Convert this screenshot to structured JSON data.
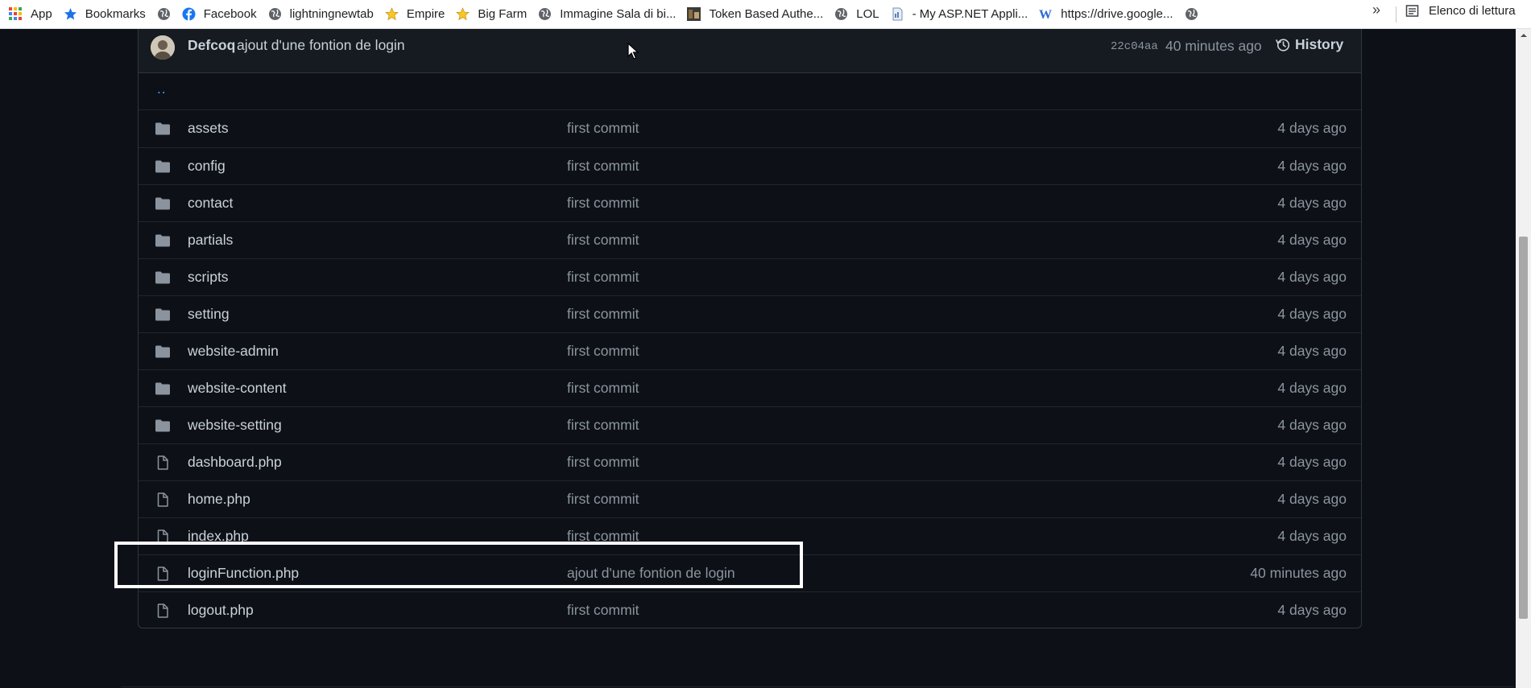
{
  "bookmarks": {
    "items": [
      {
        "label": "App",
        "icon": "apps-grid-icon"
      },
      {
        "label": "Bookmarks",
        "icon": "star-icon"
      },
      {
        "label": "",
        "icon": "globe-icon"
      },
      {
        "label": "Facebook",
        "icon": "facebook-icon"
      },
      {
        "label": "lightningnewtab",
        "icon": "globe-icon"
      },
      {
        "label": "Empire",
        "icon": "star-icon"
      },
      {
        "label": "Big Farm",
        "icon": "star-icon"
      },
      {
        "label": "Immagine Sala di bi...",
        "icon": "globe-icon"
      },
      {
        "label": "Token Based Authe...",
        "icon": "site-icon"
      },
      {
        "label": "LOL",
        "icon": "globe-icon"
      },
      {
        "label": "- My ASP.NET Appli...",
        "icon": "document-icon"
      },
      {
        "label": "https://drive.google...",
        "icon": "w-icon"
      },
      {
        "label": "",
        "icon": "globe-icon"
      }
    ],
    "overflow": "»",
    "reading_list": "Elenco di lettura"
  },
  "commit": {
    "author": "Defcoq",
    "message": "ajout d'une fontion de login",
    "sha": "22c04aa",
    "time": "40 minutes ago",
    "history_label": "History"
  },
  "parent_link": "..",
  "files": [
    {
      "name": "assets",
      "type": "folder",
      "message": "first commit",
      "age": "4 days ago"
    },
    {
      "name": "config",
      "type": "folder",
      "message": "first commit",
      "age": "4 days ago"
    },
    {
      "name": "contact",
      "type": "folder",
      "message": "first commit",
      "age": "4 days ago"
    },
    {
      "name": "partials",
      "type": "folder",
      "message": "first commit",
      "age": "4 days ago"
    },
    {
      "name": "scripts",
      "type": "folder",
      "message": "first commit",
      "age": "4 days ago"
    },
    {
      "name": "setting",
      "type": "folder",
      "message": "first commit",
      "age": "4 days ago"
    },
    {
      "name": "website-admin",
      "type": "folder",
      "message": "first commit",
      "age": "4 days ago"
    },
    {
      "name": "website-content",
      "type": "folder",
      "message": "first commit",
      "age": "4 days ago"
    },
    {
      "name": "website-setting",
      "type": "folder",
      "message": "first commit",
      "age": "4 days ago"
    },
    {
      "name": "dashboard.php",
      "type": "file",
      "message": "first commit",
      "age": "4 days ago"
    },
    {
      "name": "home.php",
      "type": "file",
      "message": "first commit",
      "age": "4 days ago"
    },
    {
      "name": "index.php",
      "type": "file",
      "message": "first commit",
      "age": "4 days ago"
    },
    {
      "name": "loginFunction.php",
      "type": "file",
      "message": "ajout d'une fontion de login",
      "age": "40 minutes ago"
    },
    {
      "name": "logout.php",
      "type": "file",
      "message": "first commit",
      "age": "4 days ago"
    }
  ],
  "colors": {
    "background": "#0d1117",
    "link": "#58a6ff",
    "icon": "#8b949e",
    "highlight_box": "#ffffff"
  }
}
